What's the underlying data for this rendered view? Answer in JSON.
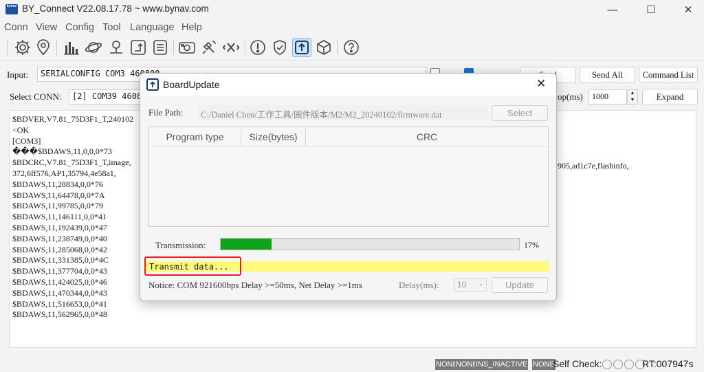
{
  "window": {
    "logo_text": "bynav",
    "title": "BY_Connect V22.08.17.78 ~ www.bynav.com",
    "minimize": "—",
    "maximize": "☐",
    "close": "✕"
  },
  "menu": [
    "Conn",
    "View",
    "Config",
    "Tool",
    "Language",
    "Help"
  ],
  "toolbar": {
    "icons": [
      "gear-icon",
      "location-pin-icon",
      "bar-chart-icon",
      "planet-icon",
      "map-pin-icon",
      "corner-route-icon",
      "list-icon",
      "camera-icon",
      "satellite-icon",
      "x-icon",
      "alert-icon",
      "shield-check-icon",
      "upload-icon",
      "cube-icon",
      "help-icon"
    ]
  },
  "input_row": {
    "label": "Input:",
    "value": "SERIALCONFIG COM3 460800",
    "send_btn": "Send",
    "send_all_btn": "Send All",
    "command_list_btn": "Command List"
  },
  "conn_row": {
    "label": "Select CONN:",
    "value": "[2] COM39 460800",
    "loop_label": "op(ms)",
    "loop_value": "1000",
    "expand_btn": "Expand"
  },
  "console": {
    "lines": [
      "$BDVER,V7.81_75D3F1_T,240102",
      "<OK",
      "[COM3]",
      "���$BDAWS,11,0,0,0*73",
      "$BDCRC,V7.81_75D3F1_T,image,",
      "372,6ff576,AP1,35794,4e58a1,",
      "$BDAWS,11,28834,0,0*76",
      "$BDAWS,11,64478,0,0*7A",
      "$BDAWS,11,99785,0,0*79",
      "$BDAWS,11,146111,0,0*41",
      "$BDAWS,11,192439,0,0*47",
      "$BDAWS,11,238749,0,0*40",
      "$BDAWS,11,285068,0,0*42",
      "$BDAWS,11,331385,0,0*4C",
      "$BDAWS,11,377704,0,0*43",
      "$BDAWS,11,424025,0,0*46",
      "$BDAWS,11,470344,0,0*43",
      "$BDAWS,11,516653,0,0*41",
      "$BDAWS,11,562965,0,0*48"
    ],
    "right_fragment": "2905,ad1c7e,flashinfo,"
  },
  "status_bar": {
    "tags": [
      "NONE",
      "NONE",
      "INS_INACTIVE",
      "NONE"
    ],
    "self_check_label": "Self Check:",
    "rt": "RT:007947s"
  },
  "dialog": {
    "title": "BoardUpdate",
    "close": "✕",
    "file_path_label": "File Path:",
    "file_path_value": "C:/Daniel Chen/工作工具/固件版本/M2/M2_20240102/firmware.dat",
    "select_btn": "Select",
    "table_headers": [
      "Program type",
      "Size(bytes)",
      "CRC"
    ],
    "transmission_label": "Transmission:",
    "progress_percent": 17,
    "progress_text": "17%",
    "status_text": "Transmit data...",
    "notice": "Notice: COM 921600bps Delay >=50ms, Net Delay >=1ms",
    "delay_label": "Delay(ms):",
    "delay_value": "10",
    "update_btn": "Update"
  },
  "colors": {
    "progress_fill": "#0fa31b",
    "status_highlight": "#fffa7a",
    "annotation_red": "#e02020",
    "accent_blue": "#1d4f9c"
  }
}
